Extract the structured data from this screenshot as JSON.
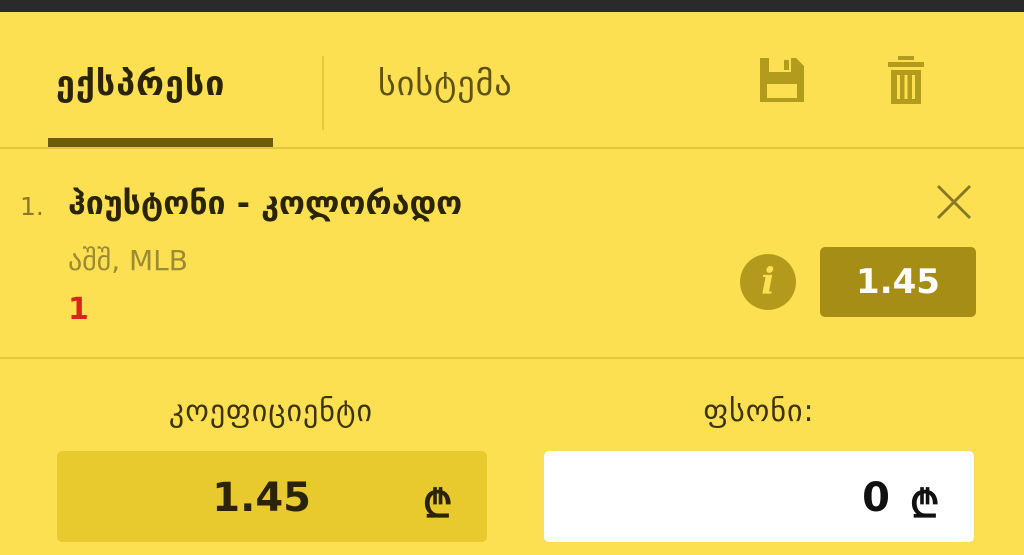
{
  "tabs": [
    {
      "label": "ექსპრესი",
      "active": true
    },
    {
      "label": "სისტემა",
      "active": false
    }
  ],
  "toolbar": {
    "save_icon": "floppy-disk-icon",
    "trash_icon": "trash-icon"
  },
  "bet": {
    "index": "1.",
    "event": "ჰიუსტონი - კოლორადო",
    "league": "აშშ, MLB",
    "pick": "1",
    "odds": "1.45",
    "info_icon": "i"
  },
  "summary": {
    "coef_label": "კოეფიციენტი",
    "coef_value": "1.45",
    "amount_label": "ფსონი:",
    "amount_value": "0",
    "currency": "₾"
  },
  "colors": {
    "background": "#FCE052",
    "accent_dark": "#6b5d0c",
    "odds_badge": "#a68d16",
    "pick_red": "#d9261c"
  }
}
